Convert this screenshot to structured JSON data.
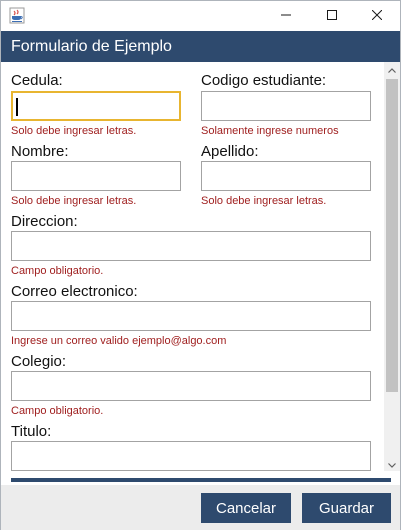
{
  "window": {
    "title": "",
    "icon": "java-cup-icon",
    "controls": [
      "minimize-icon",
      "maximize-icon",
      "close-icon"
    ]
  },
  "header": {
    "title": "Formulario de Ejemplo"
  },
  "form": {
    "cedula": {
      "label": "Cedula:",
      "value": "",
      "hint": "Solo debe ingresar letras."
    },
    "codigo": {
      "label": "Codigo estudiante:",
      "value": "",
      "hint": "Solamente ingrese numeros"
    },
    "nombre": {
      "label": "Nombre:",
      "value": "",
      "hint": "Solo debe ingresar letras."
    },
    "apellido": {
      "label": "Apellido:",
      "value": "",
      "hint": "Solo debe ingresar letras."
    },
    "direccion": {
      "label": "Direccion:",
      "value": "",
      "hint": "Campo obligatorio."
    },
    "correo": {
      "label": "Correo electronico:",
      "value": "",
      "hint": "Ingrese un correo valido ejemplo@algo.com"
    },
    "colegio": {
      "label": "Colegio:",
      "value": "",
      "hint": "Campo obligatorio."
    },
    "titulo": {
      "label": "Titulo:",
      "value": ""
    }
  },
  "footer": {
    "cancel_label": "Cancelar",
    "save_label": "Guardar"
  },
  "colors": {
    "accent": "#2e4a6e",
    "hint": "#a02020",
    "focus": "#e8b530"
  }
}
